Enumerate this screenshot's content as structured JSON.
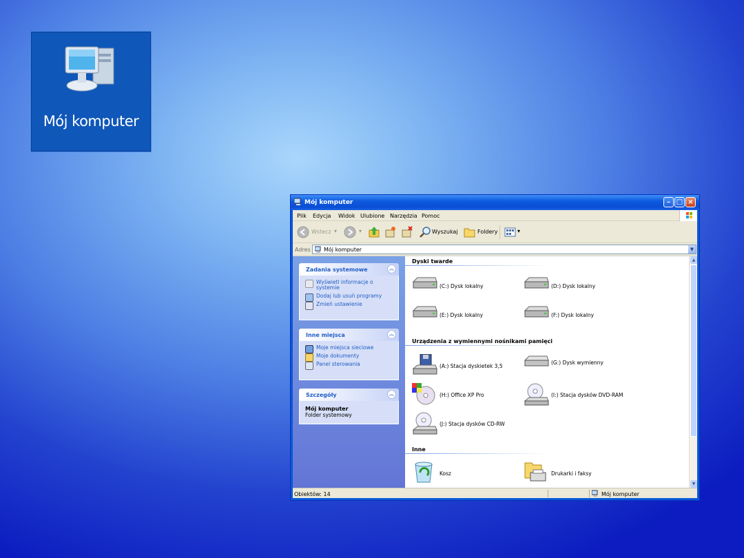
{
  "desktop_icon": {
    "label": "Mój komputer"
  },
  "window": {
    "title": "Mój komputer",
    "menu": [
      "Plik",
      "Edycja",
      "Widok",
      "Ulubione",
      "Narzędzia",
      "Pomoc"
    ],
    "toolbar": {
      "back": "Wstecz",
      "search": "Wyszukaj",
      "folders": "Foldery"
    },
    "address": {
      "label": "Adres",
      "value": "Mój komputer"
    },
    "left_panels": {
      "system_tasks": {
        "title": "Zadania systemowe",
        "items": [
          "Wyświetl informacje o systemie",
          "Dodaj lub usuń programy",
          "Zmień ustawienie"
        ]
      },
      "other_places": {
        "title": "Inne miejsca",
        "items": [
          "Moje miejsca sieciowe",
          "Moje dokumenty",
          "Panel sterowania"
        ]
      },
      "details": {
        "title": "Szczegóły",
        "name": "Mój komputer",
        "type": "Folder systemowy"
      }
    },
    "groups": {
      "hard_disks": {
        "title": "Dyski twarde",
        "items": [
          "(C:) Dysk lokalny",
          "(D:) Dysk lokalny",
          "(E:) Dysk lokalny",
          "(F:) Dysk lokalny"
        ]
      },
      "removable": {
        "title": "Urządzenia z wymiennymi nośnikami pamięci",
        "items": [
          "(A:) Stacja dyskietek 3,5",
          "(G:) Dysk wymienny",
          "(H:) Office XP Pro",
          "(I:) Stacja dysków DVD-RAM",
          "(J:) Stacja dysków CD-RW"
        ]
      },
      "other": {
        "title": "Inne",
        "items": [
          "Kosz",
          "Drukarki i faksy"
        ]
      }
    },
    "status": {
      "objects": "Obiektów: 14",
      "location": "Mój komputer"
    }
  }
}
